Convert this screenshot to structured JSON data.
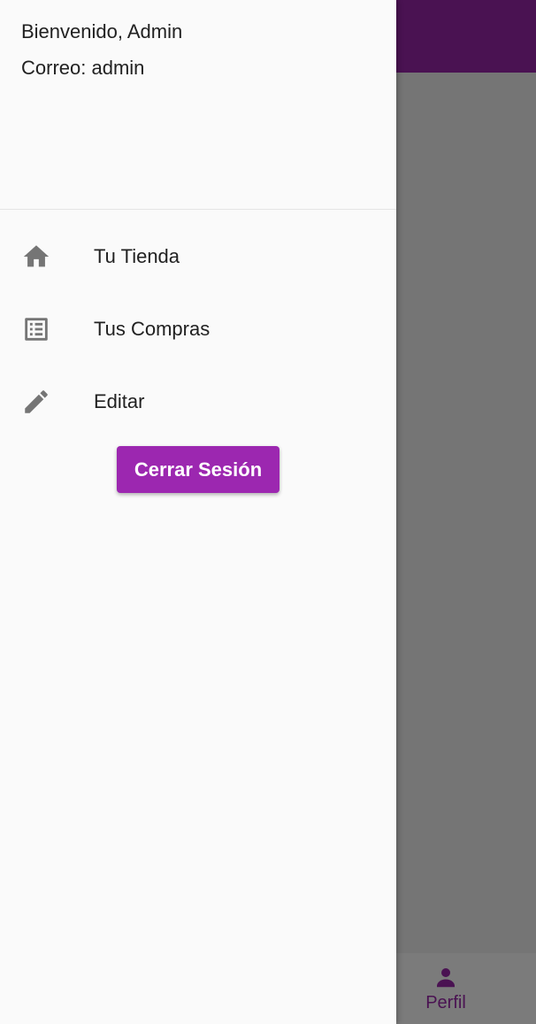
{
  "drawer": {
    "welcome_text": "Bienvenido, Admin",
    "email_text": "Correo: admin",
    "items": [
      {
        "label": "Tu Tienda",
        "icon": "home-icon"
      },
      {
        "label": "Tus Compras",
        "icon": "list-icon"
      },
      {
        "label": "Editar",
        "icon": "pencil-icon"
      }
    ],
    "logout_label": "Cerrar Sesión"
  },
  "bottom_nav": {
    "items": [
      {
        "label": "Perfil",
        "icon": "person-icon"
      }
    ]
  },
  "colors": {
    "app_bar": "#4a1252",
    "accent_button": "#9c27b0",
    "scrim": "#757575",
    "drawer_background": "#fafafa",
    "icon_grey": "#757575"
  }
}
